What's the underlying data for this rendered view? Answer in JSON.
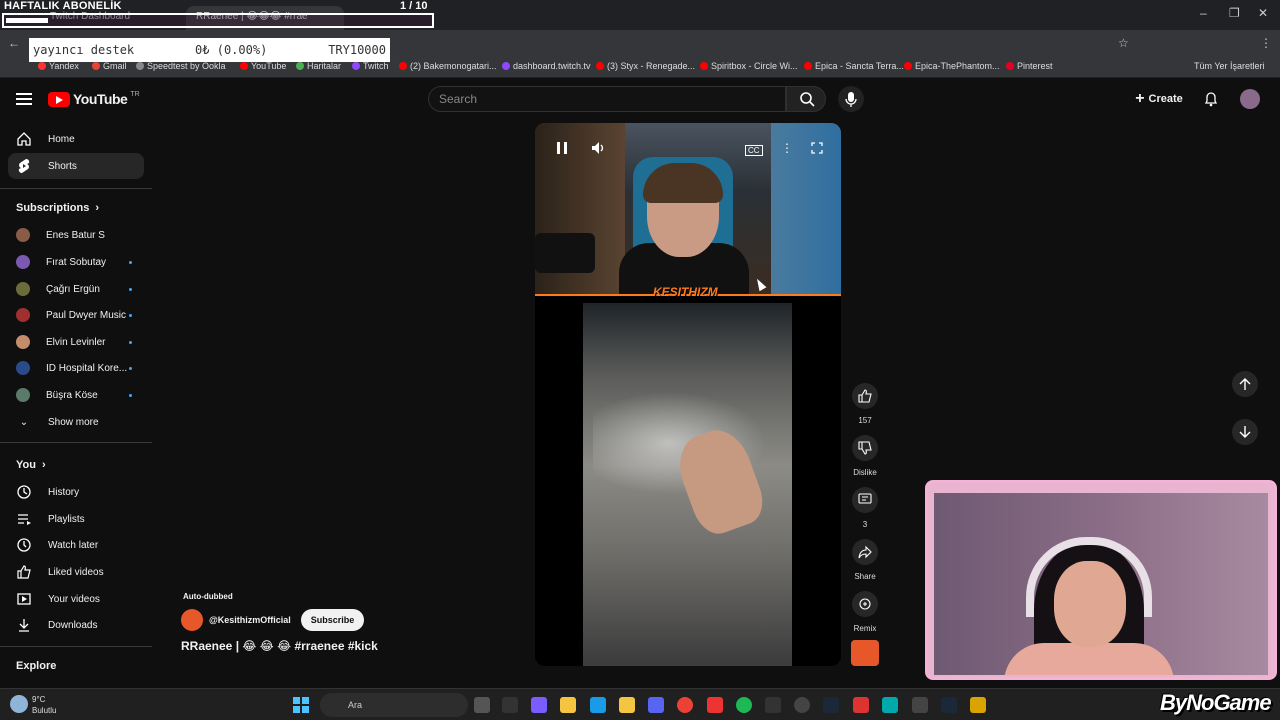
{
  "browser": {
    "tabs": [
      {
        "label": "Twitch Dashboard",
        "active": false
      },
      {
        "label": "RRaenee | 😂😂😂 #rrae",
        "active": true
      }
    ],
    "bookmarks": [
      "Yandex",
      "Gmail",
      "Speedtest by Ookla",
      "YouTube",
      "Haritalar",
      "Twitch",
      "(2) Bakemonogatari...",
      "dashboard.twitch.tv",
      "(3) Styx - Renegade...",
      "Spiritbox - Circle Wi...",
      "Epica - Sancta Terra...",
      "Epica-ThePhantom...",
      "Pinterest"
    ],
    "all_bookmarks": "Tüm Yer İşaretleri"
  },
  "overlay": {
    "weekly_title": "HAFTALIK ABONELİK",
    "counter": "1 / 10",
    "weekly_progress": 0.1,
    "donation_label": "yayıncı destek",
    "donation_amount": "0₺ (0.00%)",
    "donation_goal": "TRY10000"
  },
  "youtube": {
    "logo_text": "YouTube",
    "logo_region": "TR",
    "search_placeholder": "Search",
    "create_label": "Create"
  },
  "sidebar": {
    "main": [
      {
        "label": "Home",
        "icon": "home-icon"
      },
      {
        "label": "Shorts",
        "icon": "shorts-icon",
        "selected": true
      }
    ],
    "subscriptions_title": "Subscriptions",
    "subscriptions": [
      {
        "label": "Enes Batur S",
        "dot": false,
        "color": "#8a5b46"
      },
      {
        "label": "Fırat Sobutay",
        "dot": true,
        "color": "#7a5ab0"
      },
      {
        "label": "Çağrı Ergün",
        "dot": true,
        "color": "#6c6c3a"
      },
      {
        "label": "Paul Dwyer Music",
        "dot": true,
        "color": "#a03030"
      },
      {
        "label": "Elvin Levinler",
        "dot": true,
        "color": "#c48c6a"
      },
      {
        "label": "ID Hospital Kore...",
        "dot": true,
        "color": "#2a4a8a"
      },
      {
        "label": "Büşra Köse",
        "dot": true,
        "color": "#5a7a6a"
      }
    ],
    "show_more": "Show more",
    "you_title": "You",
    "you": [
      {
        "label": "History",
        "icon": "history-icon"
      },
      {
        "label": "Playlists",
        "icon": "playlists-icon"
      },
      {
        "label": "Watch later",
        "icon": "watch-later-icon"
      },
      {
        "label": "Liked videos",
        "icon": "like-icon"
      },
      {
        "label": "Your videos",
        "icon": "your-videos-icon"
      },
      {
        "label": "Downloads",
        "icon": "download-icon"
      }
    ],
    "explore_title": "Explore"
  },
  "short": {
    "watermark": "KESITHIZM",
    "auto_dubbed": "Auto-dubbed",
    "channel": "@KesithizmOfficial",
    "subscribe": "Subscribe",
    "title": "RRaenee | 😂 😂 😂 #rraenee #kick",
    "actions": {
      "likes": "157",
      "dislike": "Dislike",
      "comments": "3",
      "share": "Share",
      "remix": "Remix"
    }
  },
  "taskbar": {
    "temperature": "9°C",
    "weather": "Bulutlu",
    "search": "Ara"
  },
  "brand": "ByNoGame"
}
